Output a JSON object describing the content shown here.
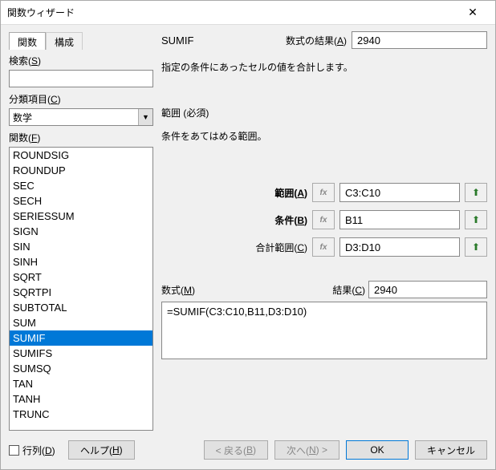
{
  "window": {
    "title": "関数ウィザード"
  },
  "tabs": {
    "functions": "関数",
    "structure": "構成"
  },
  "left": {
    "search_label_pre": "検索(",
    "search_key": "S",
    "search_label_post": ")",
    "search_value": "",
    "category_label_pre": "分類項目(",
    "category_key": "C",
    "category_label_post": ")",
    "category_value": "数学",
    "functions_label_pre": "関数(",
    "functions_key": "F",
    "functions_label_post": ")"
  },
  "function_list": [
    "ROUNDSIG",
    "ROUNDUP",
    "SEC",
    "SECH",
    "SERIESSUM",
    "SIGN",
    "SIN",
    "SINH",
    "SQRT",
    "SQRTPI",
    "SUBTOTAL",
    "SUM",
    "SUMIF",
    "SUMIFS",
    "SUMSQ",
    "TAN",
    "TANH",
    "TRUNC"
  ],
  "selected_function": "SUMIF",
  "right": {
    "fn_name": "SUMIF",
    "result_label_pre": "数式の結果(",
    "result_key": "A",
    "result_label_post": ")",
    "result_value": "2940",
    "description": "指定の条件にあったセルの値を合計します。",
    "section_title": "範囲 (必須)",
    "hint": "条件をあてはめる範囲。",
    "params": [
      {
        "label_pre": "範囲(",
        "key": "A",
        "label_post": ")",
        "value": "C3:C10",
        "bold": true
      },
      {
        "label_pre": "条件(",
        "key": "B",
        "label_post": ")",
        "value": "B11",
        "bold": true
      },
      {
        "label_pre": "合計範囲(",
        "key": "C",
        "label_post": ")",
        "value": "D3:D10",
        "bold": false
      }
    ],
    "formula_label_pre": "数式(",
    "formula_key": "M",
    "formula_label_post": ")",
    "result2_label_pre": "結果(",
    "result2_key": "C",
    "result2_label_post": ")",
    "result2_value": "2940",
    "formula_value": "=SUMIF(C3:C10,B11,D3:D10)"
  },
  "buttons": {
    "matrix_pre": "行列(",
    "matrix_key": "D",
    "matrix_post": ")",
    "help_pre": "ヘルプ(",
    "help_key": "H",
    "help_post": ")",
    "back_pre": "< 戻る(",
    "back_key": "B",
    "back_post": ")",
    "next_pre": "次へ(",
    "next_key": "N",
    "next_post": ") >",
    "ok": "OK",
    "cancel": "キャンセル"
  },
  "icons": {
    "fx": "fx",
    "ref": "⬆",
    "dropdown": "▼",
    "close": "✕"
  }
}
